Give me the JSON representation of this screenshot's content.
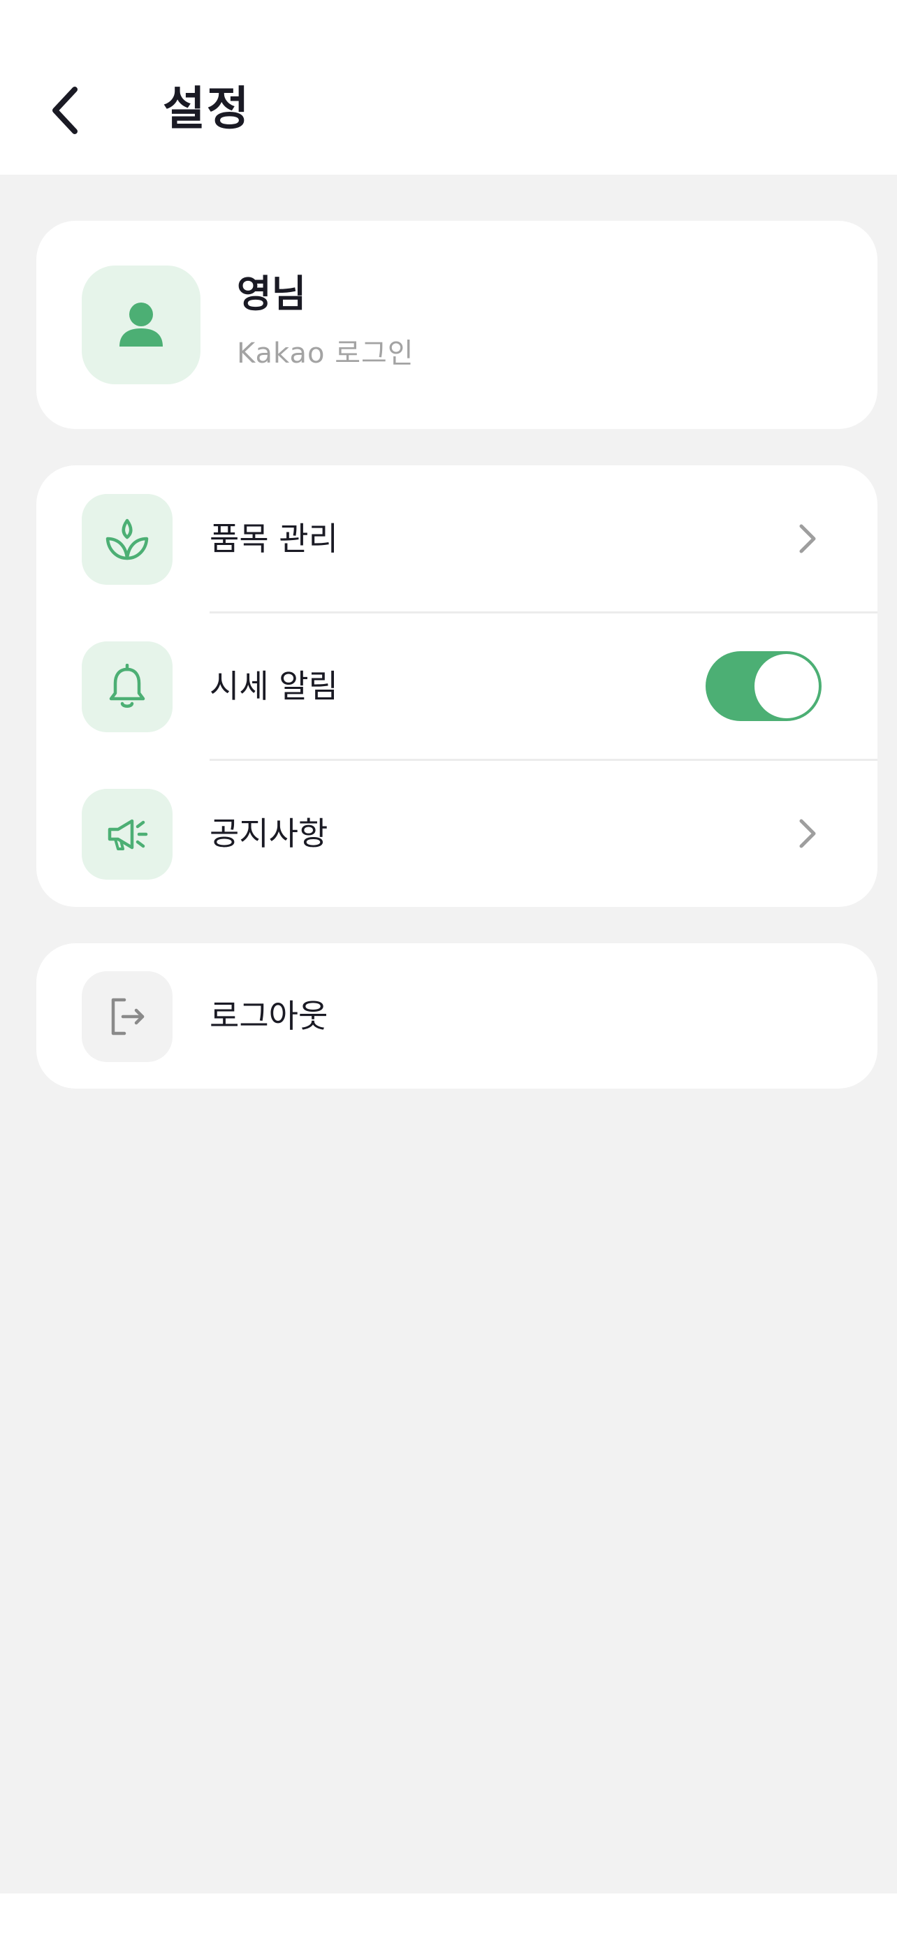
{
  "header": {
    "title": "설정",
    "back_icon": "chevron-left-icon"
  },
  "profile": {
    "name": "영님",
    "login_method": "Kakao 로그인",
    "avatar_icon": "person-icon"
  },
  "menu": {
    "items": [
      {
        "label": "품목 관리",
        "icon": "sprout-icon",
        "control": "chevron"
      },
      {
        "label": "시세 알림",
        "icon": "bell-icon",
        "control": "toggle",
        "toggle_on": true
      },
      {
        "label": "공지사항",
        "icon": "megaphone-icon",
        "control": "chevron"
      }
    ]
  },
  "logout": {
    "label": "로그아웃",
    "icon": "logout-icon"
  },
  "colors": {
    "accent": "#4caf74",
    "accent_bg": "#e6f4ea",
    "background": "#f2f2f2",
    "card": "#ffffff",
    "text": "#1a1a24",
    "subtext": "#a3a3a3"
  }
}
